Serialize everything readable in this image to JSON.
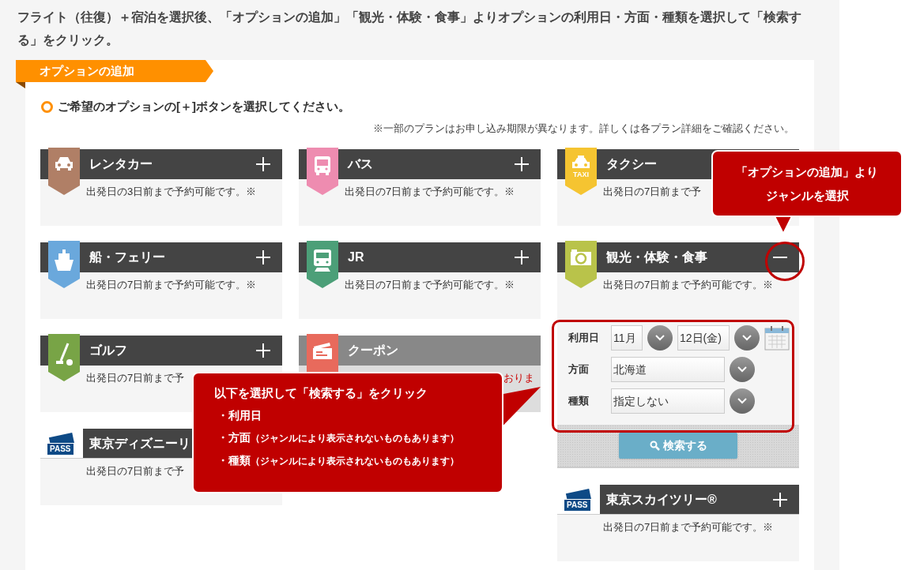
{
  "intro": "フライト（往復）＋宿泊を選択後、「オプションの追加」「観光・体験・食事」よりオプションの利用日・方面・種類を選択して「検索する」をクリック。",
  "section_tab": "オプションの追加",
  "instruction": "ご希望のオプションの[＋]ボタンを選択してください。",
  "note": "※一部のプランはお申し込み期限が異なります。詳しくは各プラン詳細をご確認ください。",
  "option_columns": [
    {
      "items": [
        {
          "kind": "car",
          "title": "レンタカー",
          "color": "#b07f66",
          "description": "出発日の3日前まで予約可能です。※",
          "expanded": false,
          "disabled": false
        },
        {
          "kind": "ship",
          "title": "船・フェリー",
          "color": "#6aa8dc",
          "description": "出発日の7日前まで予約可能です。※",
          "expanded": false,
          "disabled": false
        },
        {
          "kind": "golf",
          "title": "ゴルフ",
          "color": "#78a446",
          "description": "出発日の7日前まで予",
          "expanded": false,
          "disabled": false
        },
        {
          "kind": "pass",
          "icon_text": "PASS",
          "title": "東京ディズニーリ",
          "description": "出発日の7日前まで予",
          "disabled": false
        }
      ]
    },
    {
      "items": [
        {
          "kind": "bus",
          "title": "バス",
          "color": "#ee8cb0",
          "description": "出発日の7日前まで予約可能です。※",
          "expanded": false,
          "disabled": false
        },
        {
          "kind": "train",
          "title": "JR",
          "color": "#4c9f78",
          "description": "出発日の7日前まで予約可能です。※",
          "expanded": false,
          "disabled": false
        },
        {
          "kind": "ticket",
          "title": "クーポン",
          "color": "#e86a5c",
          "description": "おりま",
          "expanded": false,
          "disabled": true
        }
      ]
    },
    {
      "items": [
        {
          "kind": "taxi",
          "icon_text": "TAXI",
          "title": "タクシー",
          "color": "#f5c431",
          "description": "出発日の7日前まで予",
          "disabled": false
        },
        {
          "kind": "camera",
          "title": "観光・体験・食事",
          "color": "#b9c34a",
          "description": "出発日の7日前まで予約可能です。※",
          "expanded": true,
          "disabled": false
        },
        {
          "kind": "pass",
          "icon_text": "PASS",
          "title": "東京スカイツリー®",
          "description": "出発日の7日前まで予約可能です。※",
          "expanded": false,
          "disabled": false
        }
      ]
    }
  ],
  "search_form": {
    "date_label": "利用日",
    "month": "11月",
    "day": "12日(金)",
    "area_label": "方面",
    "area": "北海道",
    "type_label": "種類",
    "type": "指定しない",
    "search_button": "検索する"
  },
  "callouts": [
    {
      "lines": [
        "「オプションの追加」より",
        "ジャンルを選択"
      ]
    },
    {
      "title": "以下を選択して「検索する」をクリック",
      "bullets": [
        {
          "label": "・利用日"
        },
        {
          "label": "・方面",
          "note": "（ジャンルにより表示されないものもあります）"
        },
        {
          "label": "・種類",
          "note": "（ジャンルにより表示されないものもあります）"
        }
      ]
    }
  ]
}
